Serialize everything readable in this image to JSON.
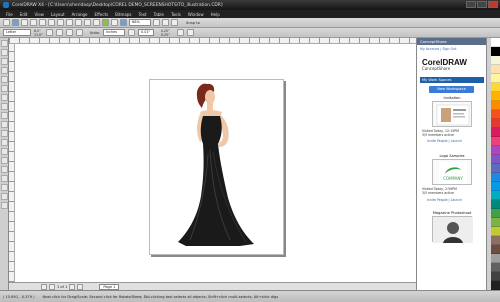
{
  "window": {
    "title": "CorelDRAW X4 - [C:\\Users\\sheridasp\\Desktop\\COREL DEMO_SCREENSHOTS\\TO_illustration.CDR]"
  },
  "menu": [
    "File",
    "Edit",
    "View",
    "Layout",
    "Arrange",
    "Effects",
    "Bitmaps",
    "Text",
    "Table",
    "Tools",
    "Window",
    "Help"
  ],
  "toolbar": {
    "zoom": "68%",
    "snap_label": "Snap to"
  },
  "propbar": {
    "page_size": "Letter",
    "width": "8.5\"",
    "height": "11.0\"",
    "units_label": "Units:",
    "units": "inches",
    "nudge": "0.01\"",
    "dup_x": "0.25\"",
    "dup_y": "0.25\""
  },
  "pagenav": {
    "page_count": "1 of 1",
    "page_tab": "Page 1"
  },
  "status": {
    "coords": "( 15.891, -0.379 )",
    "hint": "Next click for Drag/Scale; Second click for Rotate/Skew; Dbl-clicking tool selects all objects; Shift+click multi-selects; Alt+click digs"
  },
  "docker": {
    "header": "ConceptShare",
    "links": "My Account | Sign Out",
    "logo_main": "CorelDRAW",
    "logo_sub": "ConceptShare",
    "my_workspaces": "My Work Spaces",
    "new_workspace": "New Workspace",
    "workspaces": [
      {
        "name": "Invitation",
        "info": "Visited Today, 12:15PM",
        "members": "3/5 members active",
        "links": "Invite People | Launch"
      },
      {
        "name": "Logo Samples",
        "info": "Visited Today, 2:59PM",
        "members": "3/5 members active",
        "links": "Invite People | Launch",
        "thumb_text": "COMPANY"
      },
      {
        "name": "Magazine Photoshoot",
        "info": "",
        "members": "",
        "links": ""
      }
    ]
  },
  "colors": {
    "title_bar": "#151515",
    "docker_header": "#5a6e8c",
    "workspace_button": "#3b7bd6",
    "dress": "#1a1a1a",
    "skin": "#f0c8a8",
    "hair": "#7a2a1a",
    "logo_green": "#2e9e3e"
  },
  "palette": [
    "#ffffff",
    "#000000",
    "#f5f5dc",
    "#ffe0b2",
    "#fff59d",
    "#fdd835",
    "#ffb300",
    "#fb8c00",
    "#f4511e",
    "#e53935",
    "#d81b60",
    "#ec407a",
    "#ab47bc",
    "#7e57c2",
    "#5c6bc0",
    "#1e88e5",
    "#039be5",
    "#00acc1",
    "#00897b",
    "#43a047",
    "#7cb342",
    "#c0ca33",
    "#8d6e63",
    "#6d4c41",
    "#9e9e9e",
    "#616161",
    "#424242",
    "#212121"
  ]
}
